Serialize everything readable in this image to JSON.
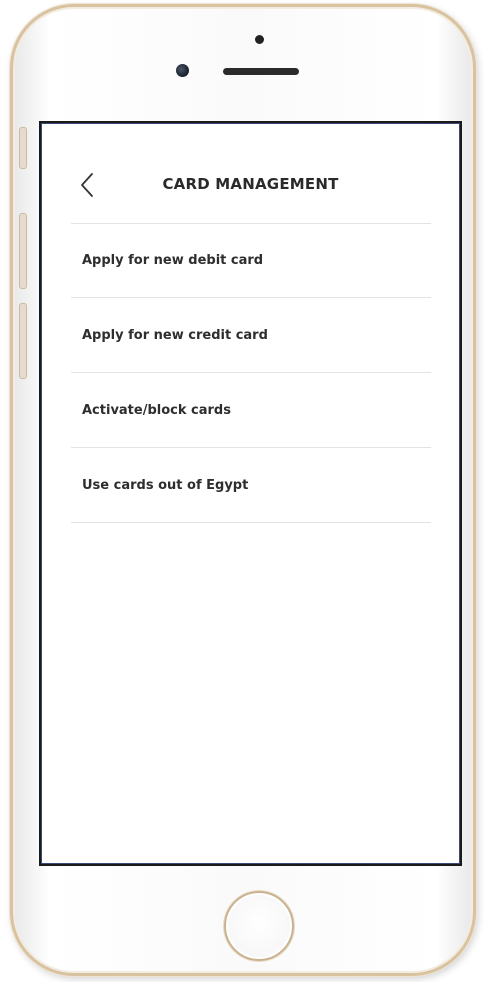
{
  "header": {
    "title": "CARD MANAGEMENT",
    "back_icon": "chevron-left-icon"
  },
  "menu": {
    "items": [
      {
        "label": "Apply for new debit card"
      },
      {
        "label": "Apply for new credit card"
      },
      {
        "label": "Activate/block cards"
      },
      {
        "label": "Use cards out of Egypt"
      }
    ]
  },
  "colors": {
    "frame_gold": "#d9c2a0",
    "text_dark": "#2a2a2a",
    "divider": "#e3e3e3"
  }
}
